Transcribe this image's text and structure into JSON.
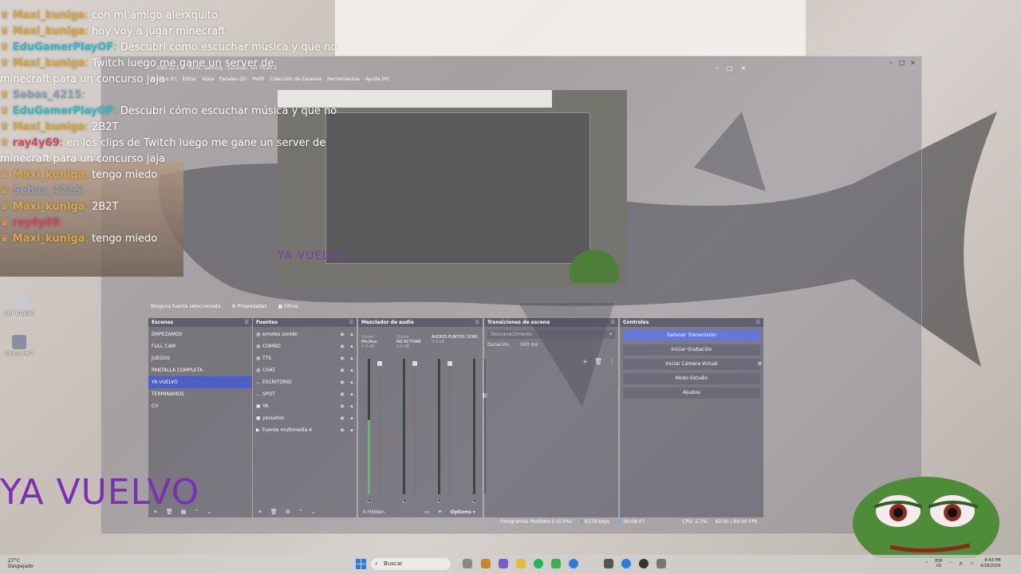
{
  "chat": [
    {
      "user": "Maxi_kuniga",
      "user_class": "u-maxi",
      "msg": "con mi amigo alerxquito"
    },
    {
      "user": "Maxi_kuniga",
      "user_class": "u-maxi",
      "msg": "hoy voy a jugar minecraft"
    },
    {
      "user": "EduGamerPlayOF",
      "user_class": "u-edu",
      "msg": "Descubri como escuchar musica y que no"
    },
    {
      "user": "Maxi_kuniga",
      "user_class": "u-maxi",
      "msg": "Twitch luego me gane un server de"
    },
    {
      "user": "",
      "user_class": "u-maxi",
      "msg": "minecraft para un concurso jaja"
    },
    {
      "user": "Sebas_4215",
      "user_class": "u-sebas",
      "msg": ""
    },
    {
      "user": "EduGamerPlayOF",
      "user_class": "u-edu",
      "msg": "Descubri cómo escuchar música y que no"
    },
    {
      "user": "Maxi_kuniga",
      "user_class": "u-maxi",
      "msg": "2B2T"
    },
    {
      "user": "ray4y69",
      "user_class": "u-ray",
      "msg": "en los clips de Twitch luego me gane un server de"
    },
    {
      "user": "",
      "user_class": "u-maxi",
      "msg": "minecraft para un concurso jaja"
    },
    {
      "user": "Maxi_kuniga",
      "user_class": "u-maxi",
      "msg": "tengo miedo"
    },
    {
      "user": "Sebas_4215",
      "user_class": "u-sebas",
      "msg": ""
    },
    {
      "user": "Maxi_kuniga",
      "user_class": "u-maxi",
      "msg": "2B2T"
    },
    {
      "user": "ray4y69",
      "user_class": "u-ray",
      "msg": ""
    },
    {
      "user": "Maxi_kuniga",
      "user_class": "u-maxi",
      "msg": "tengo miedo"
    }
  ],
  "overlay": {
    "ya_vuelvo": "YA VUELVO"
  },
  "desktop": {
    "icons": [
      {
        "label": "CLIP STUDIO"
      },
      {
        "label": "Chatterino7"
      }
    ]
  },
  "obs": {
    "title": "OBS 32.1.1 - Perfil: Gaming - Escenas: Sin Título 2",
    "menu": [
      "Archivo (F)",
      "Editar",
      "Vista",
      "Paneles (D)",
      "Perfil",
      "Colección de Escenas",
      "Herramientas",
      "Ayuda (H)"
    ],
    "preview_text": "YA VUELVO",
    "no_source": "Ninguna fuente seleccionada",
    "properties": "Propiedades",
    "filters": "Filtros",
    "docks": {
      "scenes": {
        "title": "Escenas",
        "items": [
          "EMPEZAMOS",
          "FULL CAM",
          "JUEGOS",
          "PANTALLA COMPLETA",
          "YA VUELVO",
          "TERMINAMOS",
          "CV"
        ],
        "active_index": 4
      },
      "sources": {
        "title": "Fuentes",
        "items": [
          {
            "label": "emotes sonido",
            "icon": "browser-icon"
          },
          {
            "label": "COMBO",
            "icon": "browser-icon"
          },
          {
            "label": "TTS",
            "icon": "browser-icon"
          },
          {
            "label": "CHAT",
            "icon": "browser-icon"
          },
          {
            "label": "ESCRITORIO",
            "icon": "speaker-icon"
          },
          {
            "label": "SPOT",
            "icon": "speaker-icon"
          },
          {
            "label": "YA",
            "icon": "image-icon"
          },
          {
            "label": "yavuelvo",
            "icon": "image-icon"
          },
          {
            "label": "Fuente multimedia 4",
            "icon": "play-icon"
          }
        ]
      },
      "mixer": {
        "title": "Mezclador de audio",
        "channels": [
          {
            "label": "Mic/Aux",
            "tag": "Global",
            "db": "0.0 dB"
          },
          {
            "label": "NO ACTIVAR",
            "tag": "Global",
            "db": "0.0 dB"
          },
          {
            "label": "AUDIOS PUNTOS",
            "tag": "",
            "db": "0.0 dB"
          },
          {
            "label": "DONC",
            "tag": "",
            "db": ""
          }
        ],
        "hidden": "0 Hidden",
        "options": "Options"
      },
      "transitions": {
        "title": "Transiciones de escena",
        "selected": "Desvanecimiento",
        "duration_label": "Duración",
        "duration_value": "300 ms"
      },
      "controls": {
        "title": "Controles",
        "buttons": [
          "Detener Transmisión",
          "Iniciar Grabación",
          "Iniciar Cámara Virtual",
          "Modo Estudio",
          "Ajustes"
        ]
      }
    },
    "status": {
      "dropped": "Fotogramas Perdidos 0 (0.0%)",
      "bitrate": "6378 kbps",
      "live_time": "00:08:07",
      "rec_time": "00:00:00",
      "cpu": "CPU: 2.7%",
      "fps": "60.00 / 60.00 FPS"
    }
  },
  "taskbar": {
    "weather_temp": "27°C",
    "weather_desc": "Despejado",
    "search": "Buscar",
    "lang": "ESP",
    "region": "US",
    "time": "8:43 PM",
    "date": "4/18/2026"
  },
  "colors": {
    "accent": "#4f5fc4",
    "stop_button": "#6677d8",
    "ya_vuelvo": "#7b2fb5",
    "meter_green": "#5cc15c"
  }
}
